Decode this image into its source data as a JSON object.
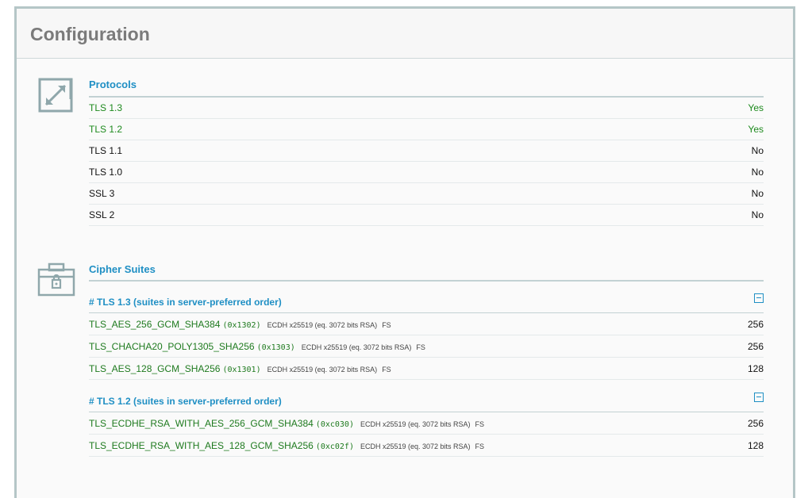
{
  "panel": {
    "title": "Configuration"
  },
  "protocols": {
    "title": "Protocols",
    "icon": "resize-arrows-icon",
    "rows": [
      {
        "label": "TLS 1.3",
        "value": "Yes",
        "status": "good"
      },
      {
        "label": "TLS 1.2",
        "value": "Yes",
        "status": "good"
      },
      {
        "label": "TLS 1.1",
        "value": "No",
        "status": "plain"
      },
      {
        "label": "TLS 1.0",
        "value": "No",
        "status": "plain"
      },
      {
        "label": "SSL 3",
        "value": "No",
        "status": "plain"
      },
      {
        "label": "SSL 2",
        "value": "No",
        "status": "plain"
      }
    ]
  },
  "cipher_suites": {
    "title": "Cipher Suites",
    "icon": "toolbox-lock-icon",
    "groups": [
      {
        "heading": "# TLS 1.3 (suites in server-preferred order)",
        "suites": [
          {
            "name": "TLS_AES_256_GCM_SHA384",
            "code": "(0x1302)",
            "meta": "ECDH x25519 (eq. 3072 bits RSA)",
            "fs": "FS",
            "bits": "256"
          },
          {
            "name": "TLS_CHACHA20_POLY1305_SHA256",
            "code": "(0x1303)",
            "meta": "ECDH x25519 (eq. 3072 bits RSA)",
            "fs": "FS",
            "bits": "256"
          },
          {
            "name": "TLS_AES_128_GCM_SHA256",
            "code": "(0x1301)",
            "meta": "ECDH x25519 (eq. 3072 bits RSA)",
            "fs": "FS",
            "bits": "128"
          }
        ]
      },
      {
        "heading": "# TLS 1.2 (suites in server-preferred order)",
        "suites": [
          {
            "name": "TLS_ECDHE_RSA_WITH_AES_256_GCM_SHA384",
            "code": "(0xc030)",
            "meta": "ECDH x25519 (eq. 3072 bits RSA)",
            "fs": "FS",
            "bits": "256"
          },
          {
            "name": "TLS_ECDHE_RSA_WITH_AES_128_GCM_SHA256",
            "code": "(0xc02f)",
            "meta": "ECDH x25519 (eq. 3072 bits RSA)",
            "fs": "FS",
            "bits": "128"
          }
        ]
      }
    ]
  },
  "colors": {
    "accent": "#1f8fc4",
    "good": "#1e8a1e",
    "border": "#b5c6c7"
  }
}
